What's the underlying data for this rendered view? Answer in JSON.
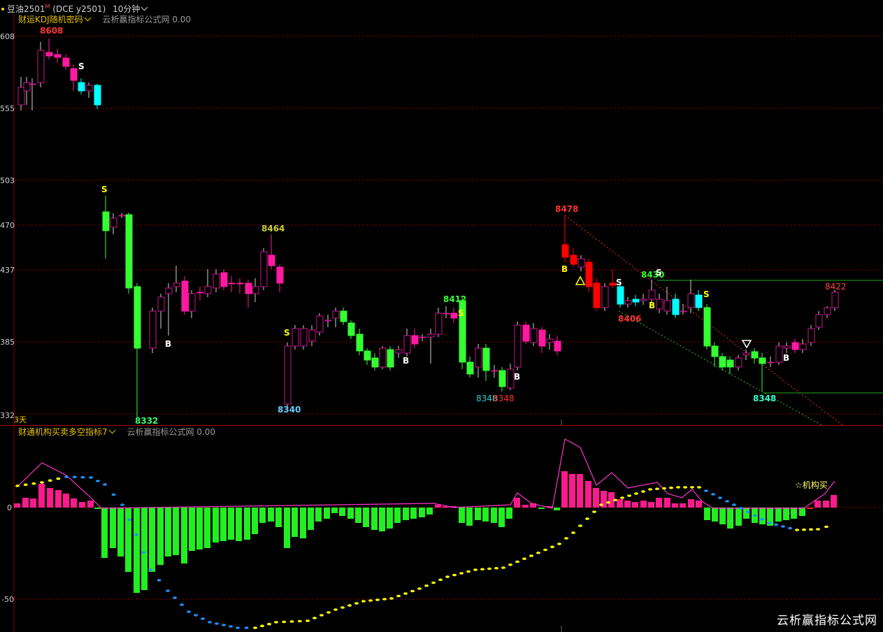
{
  "header": {
    "symbol": "豆油2501",
    "superscript": "M",
    "contract": "(DCE y2501)",
    "period": "10分钟"
  },
  "main_indicator": {
    "name": "财运KDJ随机密码",
    "source": "云析赢指标公式网",
    "value": "0.00"
  },
  "sub_indicator": {
    "name": "财通机构买卖多空指标7",
    "source": "云析赢指标公式网",
    "value": "0.00"
  },
  "days_label": "3天",
  "watermark": "云析赢指标公式网",
  "colors": {
    "up": "#ff3355",
    "down": "#33ff33",
    "magenta": "#ff1493",
    "cyan": "#00ffff",
    "yellow": "#ffff00",
    "blue": "#1e90ff",
    "grid": "#7a0000"
  },
  "chart_data": [
    {
      "type": "candlestick",
      "y_axis_ticks": [
        "608",
        "555",
        "503",
        "470",
        "437",
        "385",
        "332"
      ],
      "ylim": [
        8332,
        8608
      ],
      "price_labels": [
        "8608",
        "8332",
        "8464",
        "8340",
        "8412",
        "8348",
        "8348",
        "8478",
        "8406",
        "8430",
        "8422",
        "8348"
      ],
      "signals": [
        "S",
        "S",
        "B",
        "S",
        "B",
        "S",
        "B",
        "B",
        "S",
        "B",
        "S",
        "B"
      ]
    },
    {
      "type": "bar",
      "y_axis_ticks": [
        "0",
        "-50"
      ],
      "annotation": "☆机构买"
    }
  ]
}
